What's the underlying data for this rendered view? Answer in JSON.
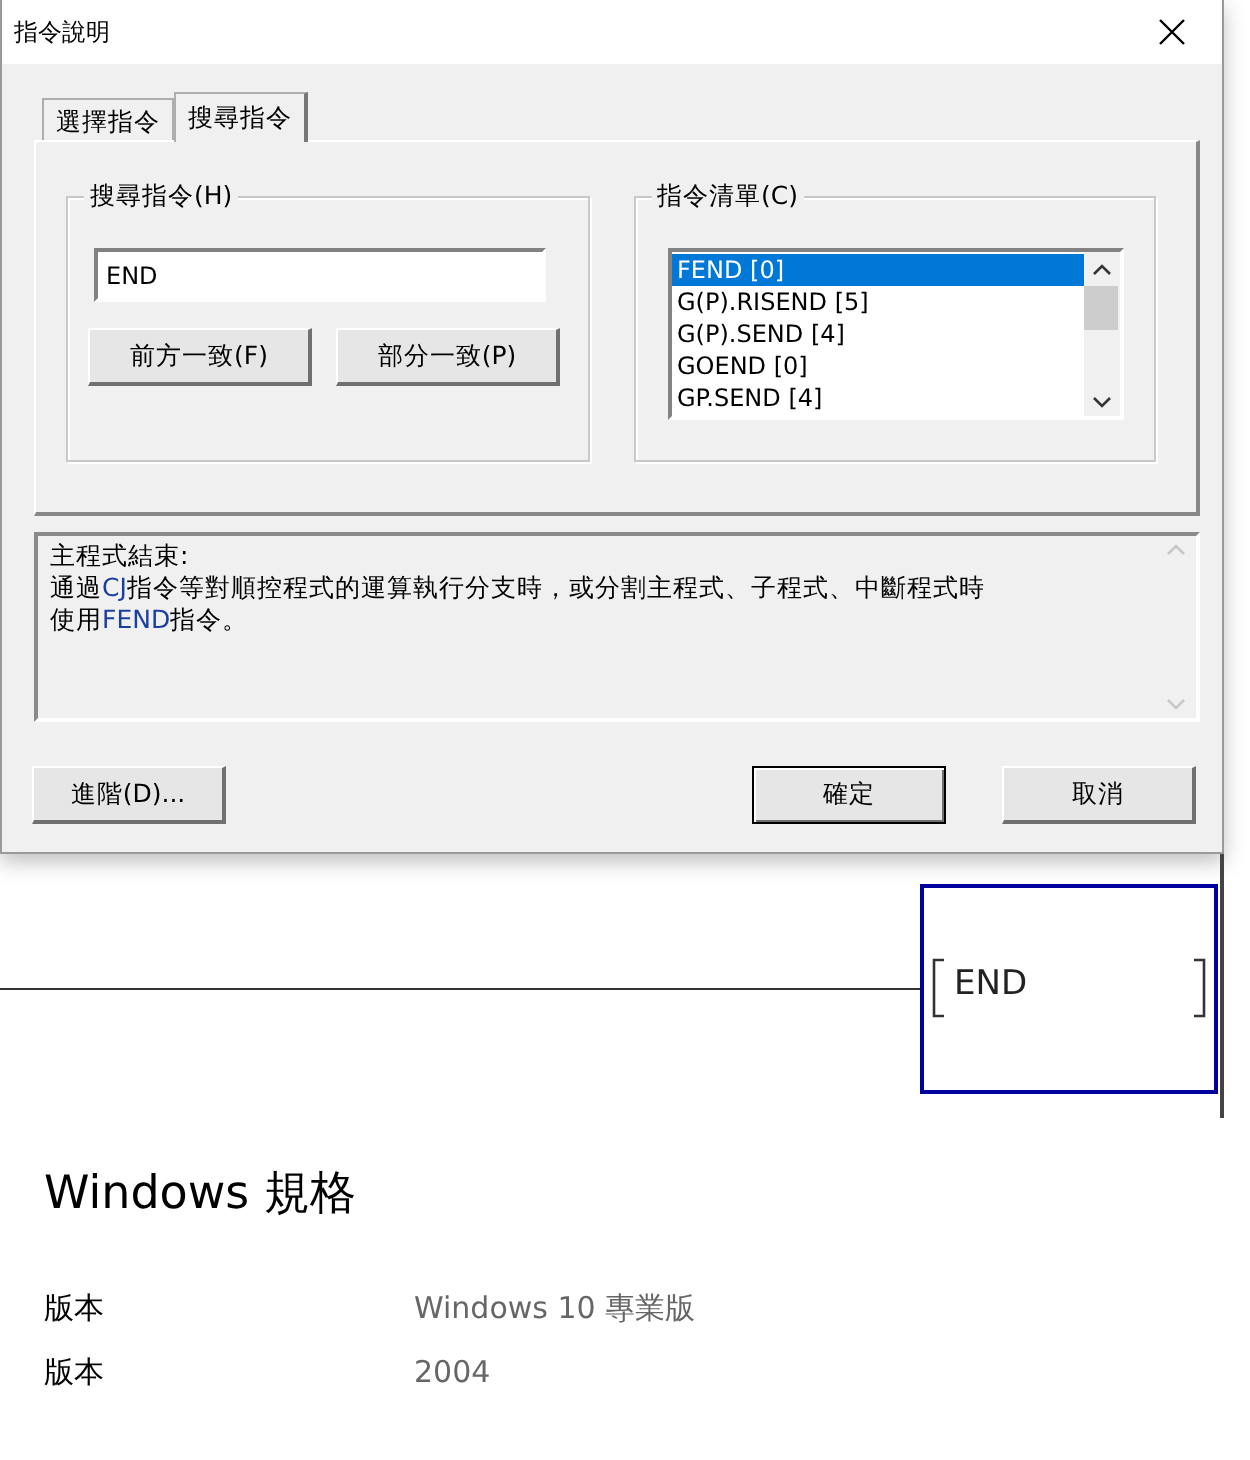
{
  "dialog": {
    "title": "指令說明",
    "tabs": [
      {
        "label": "選擇指令",
        "selected": false
      },
      {
        "label": "搜尋指令",
        "selected": true
      }
    ],
    "search_group": {
      "title": "搜尋指令(H)",
      "value": "END",
      "buttons": [
        "前方一致(F)",
        "部分一致(P)"
      ]
    },
    "list_group": {
      "title": "指令清單(C)",
      "items": [
        {
          "label": "FEND [0]",
          "selected": true
        },
        {
          "label": "G(P).RISEND [5]",
          "selected": false
        },
        {
          "label": "G(P).SEND [4]",
          "selected": false
        },
        {
          "label": "GOEND [0]",
          "selected": false
        },
        {
          "label": "GP.SEND [4]",
          "selected": false
        }
      ]
    },
    "description": [
      [
        {
          "text": "主程式結束:",
          "code": false
        }
      ],
      [
        {
          "text": "通過",
          "code": false
        },
        {
          "text": "CJ",
          "code": true
        },
        {
          "text": "指令等對順控程式的運算執行分支時，或分割主程式、子程式、中斷程式時",
          "code": false
        }
      ],
      [
        {
          "text": "使用",
          "code": false
        },
        {
          "text": "FEND",
          "code": true
        },
        {
          "text": "指令。",
          "code": false
        }
      ]
    ],
    "buttons": [
      {
        "label": "進階(D)...",
        "default": false
      },
      {
        "label": "確定",
        "default": true
      },
      {
        "label": "取消",
        "default": false
      }
    ]
  },
  "ladder": {
    "instruction": "END"
  },
  "specs": {
    "title": "Windows 規格",
    "rows": [
      {
        "label": "版本",
        "value": "Windows 10 專業版"
      },
      {
        "label": "版本",
        "value": "2004"
      }
    ]
  }
}
